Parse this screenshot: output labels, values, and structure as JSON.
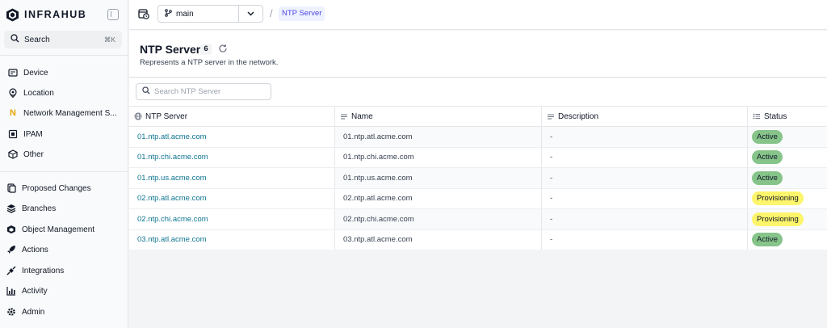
{
  "app": {
    "name": "INFRAHUB"
  },
  "sidebar": {
    "search": {
      "label": "Search",
      "shortcut": "⌘K"
    },
    "primary": [
      {
        "label": "Device",
        "icon": "device-icon"
      },
      {
        "label": "Location",
        "icon": "location-pin-icon"
      },
      {
        "label": "Network Management S...",
        "icon": "network-n-icon"
      },
      {
        "label": "IPAM",
        "icon": "ipam-icon"
      },
      {
        "label": "Other",
        "icon": "cube-icon"
      }
    ],
    "secondary": [
      {
        "label": "Proposed Changes",
        "icon": "proposed-changes-icon"
      },
      {
        "label": "Branches",
        "icon": "layers-icon"
      },
      {
        "label": "Object Management",
        "icon": "object-management-icon"
      },
      {
        "label": "Actions",
        "icon": "rocket-icon"
      },
      {
        "label": "Integrations",
        "icon": "plug-icon"
      },
      {
        "label": "Activity",
        "icon": "activity-chart-icon"
      },
      {
        "label": "Admin",
        "icon": "gear-icon"
      }
    ]
  },
  "topbar": {
    "branch": "main",
    "breadcrumb_sep": "/",
    "breadcrumb": "NTP Server"
  },
  "page": {
    "title": "NTP Server",
    "count": "6",
    "description": "Represents a NTP server in the network."
  },
  "filter": {
    "placeholder": "Search NTP Server"
  },
  "table": {
    "columns": [
      "NTP Server",
      "Name",
      "Description",
      "Status"
    ],
    "rows": [
      {
        "server": "01.ntp.atl.acme.com",
        "name": "01.ntp.atl.acme.com",
        "description": "-",
        "status": "Active"
      },
      {
        "server": "01.ntp.chi.acme.com",
        "name": "01.ntp.chi.acme.com",
        "description": "-",
        "status": "Active"
      },
      {
        "server": "01.ntp.us.acme.com",
        "name": "01.ntp.us.acme.com",
        "description": "-",
        "status": "Active"
      },
      {
        "server": "02.ntp.atl.acme.com",
        "name": "02.ntp.atl.acme.com",
        "description": "-",
        "status": "Provisioning"
      },
      {
        "server": "02.ntp.chi.acme.com",
        "name": "02.ntp.chi.acme.com",
        "description": "-",
        "status": "Provisioning"
      },
      {
        "server": "03.ntp.atl.acme.com",
        "name": "03.ntp.atl.acme.com",
        "description": "-",
        "status": "Active"
      }
    ]
  },
  "colors": {
    "status_active": "#86c48a",
    "status_provisioning": "#fdf56b",
    "link": "#0e7490",
    "breadcrumb_accent": "#4f46e5"
  }
}
